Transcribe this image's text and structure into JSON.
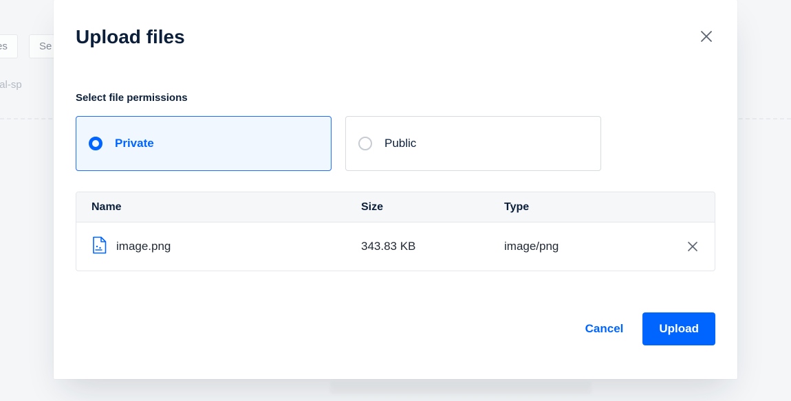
{
  "bg": {
    "tab1": "es",
    "tab2": "Se",
    "text": "utorial-sp"
  },
  "modal": {
    "title": "Upload files",
    "permissions": {
      "label": "Select file permissions",
      "options": [
        {
          "label": "Private",
          "selected": true
        },
        {
          "label": "Public",
          "selected": false
        }
      ]
    },
    "table": {
      "headers": {
        "name": "Name",
        "size": "Size",
        "type": "Type"
      },
      "rows": [
        {
          "name": "image.png",
          "size": "343.83 KB",
          "type": "image/png"
        }
      ]
    },
    "buttons": {
      "cancel": "Cancel",
      "upload": "Upload"
    }
  }
}
